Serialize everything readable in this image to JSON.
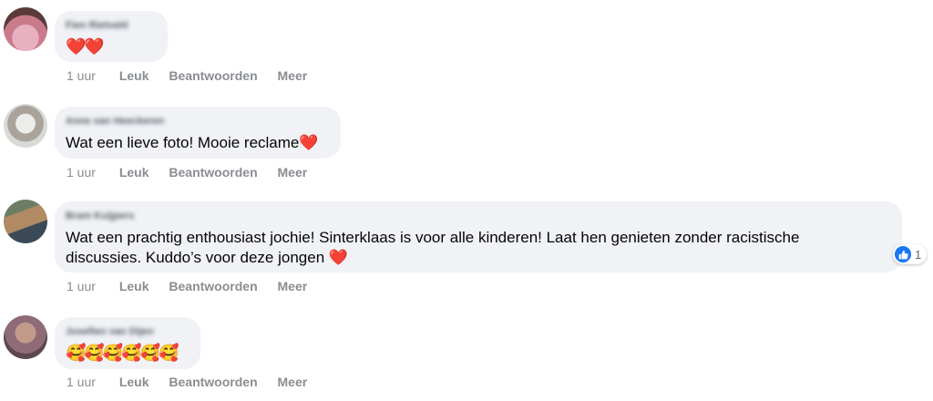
{
  "comments": [
    {
      "author": "Fien Rietveld",
      "text": "❤️❤️",
      "time": "1 uur",
      "like_label": "Leuk",
      "reply_label": "Beantwoorden",
      "more_label": "Meer",
      "avatar_colors": [
        "#c97b8c",
        "#e9b0c2",
        "#5b3a3a"
      ]
    },
    {
      "author": "Anne van Heeckeren",
      "text": "Wat een lieve foto! Mooie reclame❤️",
      "time": "1 uur",
      "like_label": "Leuk",
      "reply_label": "Beantwoorden",
      "more_label": "Meer",
      "avatar_colors": [
        "#d9d9d6",
        "#a9a39b",
        "#ececea"
      ]
    },
    {
      "author": "Bram Kuijpers",
      "text": "Wat een prachtig enthousiast jochie! Sinterklaas is voor alle kinderen! Laat hen genieten zonder racistische\ndiscussies. Kuddo’s voor deze jongen ❤️",
      "time": "1 uur",
      "like_label": "Leuk",
      "reply_label": "Beantwoorden",
      "more_label": "Meer",
      "reaction_count": "1",
      "avatar_colors": [
        "#3b4a56",
        "#b08a62",
        "#6d7d63"
      ]
    },
    {
      "author": "Josefien van Dijen",
      "text": "🥰🥰🥰🥰🥰🥰",
      "time": "1 uur",
      "like_label": "Leuk",
      "reply_label": "Beantwoorden",
      "more_label": "Meer",
      "avatar_colors": [
        "#8f6b78",
        "#c29a8a",
        "#5c4750"
      ]
    }
  ],
  "colors": {
    "bubble": "#f0f2f5",
    "action_text": "#8a8d91",
    "like_blue": "#1877f2"
  }
}
